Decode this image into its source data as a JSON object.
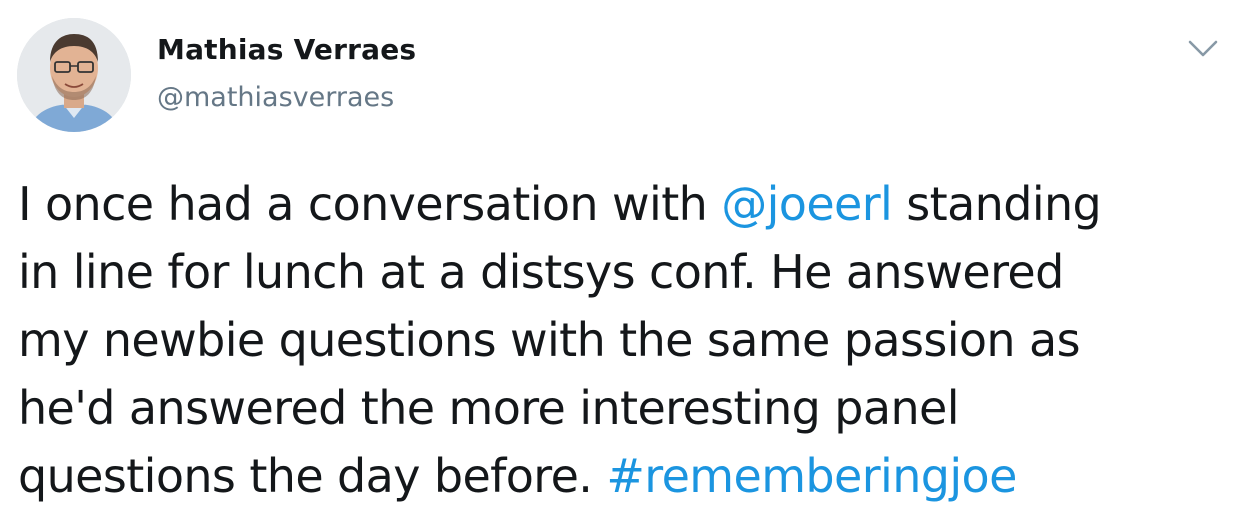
{
  "author": {
    "display_name": "Mathias Verraes",
    "handle": "@mathiasverraes",
    "avatar_icon": "profile-photo"
  },
  "menu": {
    "icon": "chevron-down-icon"
  },
  "tweet": {
    "line1": {
      "before": "I once had a conversation with ",
      "mention": "@joeerl",
      "after": " standing"
    },
    "line2": "in line for lunch at a distsys conf. He answered",
    "line3": "my newbie questions with the same passion as",
    "line4": "he'd answered the more interesting panel",
    "line5": {
      "before": "questions the day before. ",
      "hashtag": "#rememberingjoe"
    }
  },
  "colors": {
    "text": "#14171a",
    "secondary": "#657786",
    "link": "#1b95e0"
  }
}
